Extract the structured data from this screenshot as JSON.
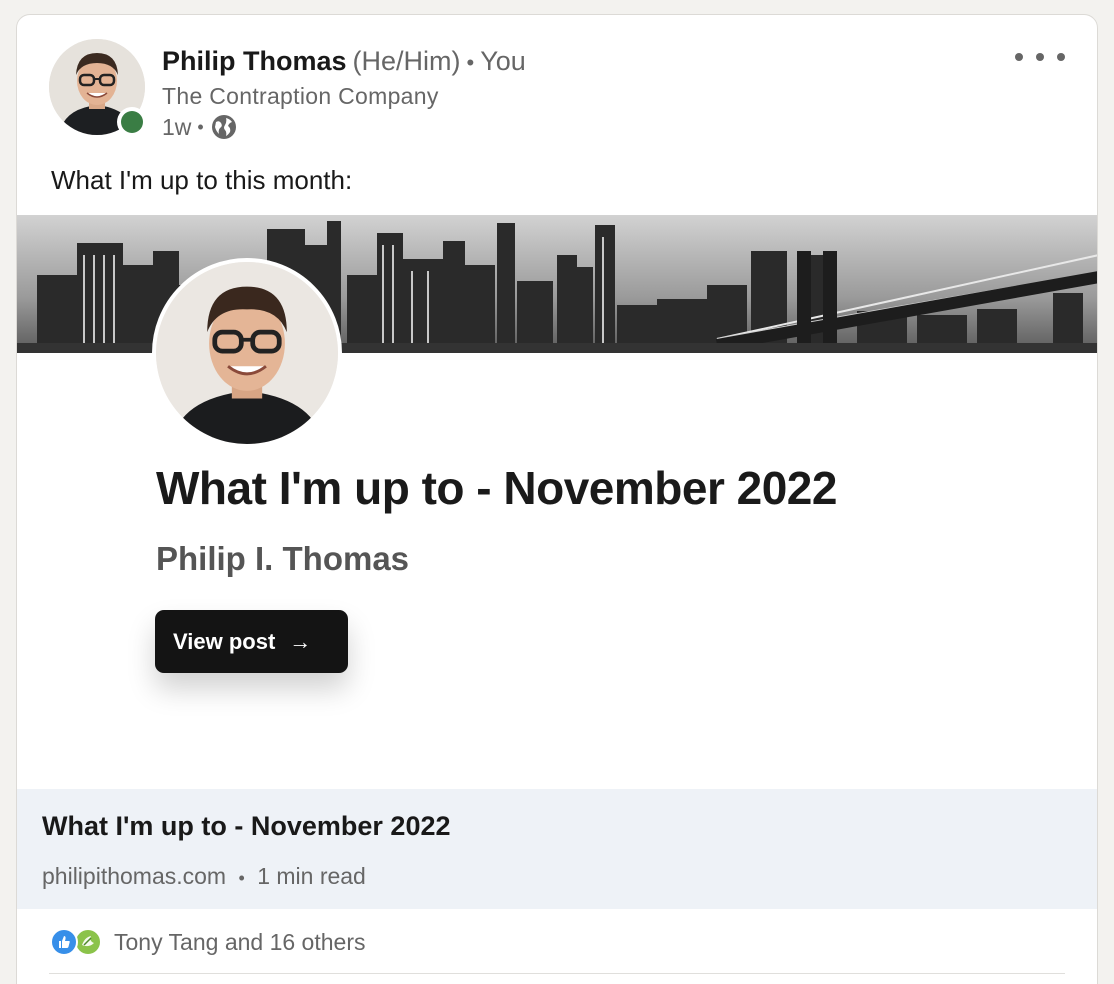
{
  "post": {
    "author_name": "Philip Thomas",
    "pronouns": "(He/Him)",
    "relation": "You",
    "company": "The Contraption Company",
    "age": "1w",
    "visibility_icon": "globe-icon",
    "more_icon": "ellipsis-icon",
    "text": "What I'm up to this month:",
    "presence_color": "#3a7d44"
  },
  "article": {
    "hero_title": "What I'm up to - November 2022",
    "hero_author": "Philip I. Thomas",
    "cta_label": "View post",
    "cta_arrow": "→",
    "link_title": "What I'm up to - November 2022",
    "domain": "philipithomas.com",
    "read_time": "1 min read"
  },
  "social": {
    "reaction_icons": [
      "like-icon",
      "support-icon"
    ],
    "summary": "Tony Tang and 16 others"
  },
  "separator": "•"
}
